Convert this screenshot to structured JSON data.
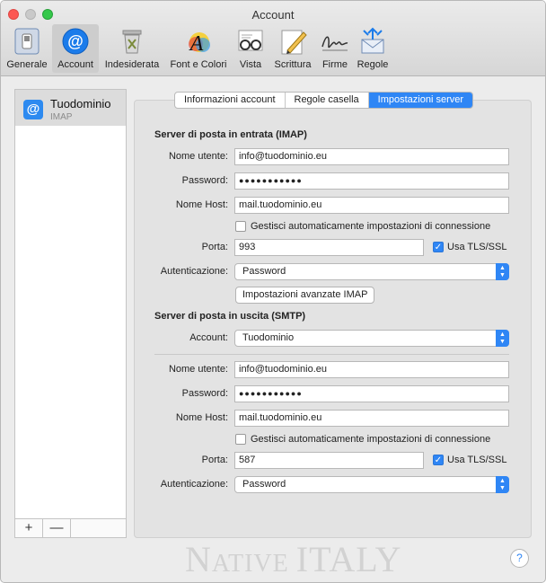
{
  "window": {
    "title": "Account"
  },
  "toolbar": {
    "items": [
      {
        "label": "Generale",
        "icon": "switch-icon"
      },
      {
        "label": "Account",
        "icon": "at-icon"
      },
      {
        "label": "Indesiderata",
        "icon": "trash-icon"
      },
      {
        "label": "Font e Colori",
        "icon": "font-icon"
      },
      {
        "label": "Vista",
        "icon": "glasses-icon"
      },
      {
        "label": "Scrittura",
        "icon": "pencil-icon"
      },
      {
        "label": "Firme",
        "icon": "signature-icon"
      },
      {
        "label": "Regole",
        "icon": "rules-icon"
      }
    ],
    "selected": "Account"
  },
  "sidebar": {
    "account_name": "Tuodominio",
    "account_type": "IMAP",
    "add_label": "+",
    "remove_label": "—"
  },
  "tabs": [
    "Informazioni account",
    "Regole casella",
    "Impostazioni server"
  ],
  "selected_tab": "Impostazioni server",
  "incoming": {
    "title": "Server di posta in entrata (IMAP)",
    "username_label": "Nome utente:",
    "username": "info@tuodominio.eu",
    "password_label": "Password:",
    "password": "●●●●●●●●●●●",
    "host_label": "Nome Host:",
    "host": "mail.tuodominio.eu",
    "auto_manage_label": "Gestisci automaticamente impostazioni di connessione",
    "auto_manage": false,
    "port_label": "Porta:",
    "port": "993",
    "tls_label": "Usa TLS/SSL",
    "tls": true,
    "auth_label": "Autenticazione:",
    "auth": "Password",
    "advanced_button": "Impostazioni avanzate IMAP"
  },
  "outgoing": {
    "title": "Server di posta in uscita (SMTP)",
    "account_label": "Account:",
    "account": "Tuodominio",
    "username_label": "Nome utente:",
    "username": "info@tuodominio.eu",
    "password_label": "Password:",
    "password": "●●●●●●●●●●●",
    "host_label": "Nome Host:",
    "host": "mail.tuodominio.eu",
    "auto_manage_label": "Gestisci automaticamente impostazioni di connessione",
    "auto_manage": false,
    "port_label": "Porta:",
    "port": "587",
    "tls_label": "Usa TLS/SSL",
    "tls": true,
    "auth_label": "Autenticazione:",
    "auth": "Password"
  },
  "watermark": {
    "part1": "N",
    "part2": "ATIVE ",
    "part3": "ITALY"
  },
  "help_label": "?",
  "colors": {
    "accent": "#2f86f5",
    "close": "#fc5753",
    "zoom": "#34c84a"
  }
}
